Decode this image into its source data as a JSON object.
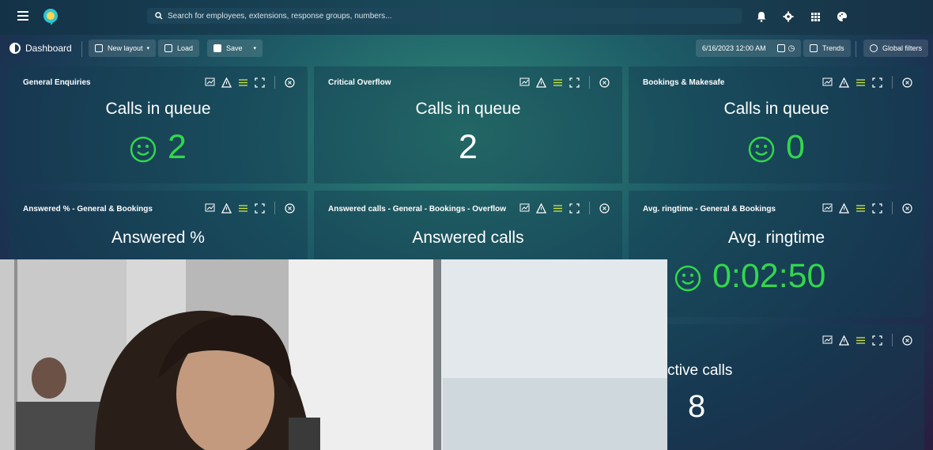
{
  "topbar": {
    "search_placeholder": "Search for employees, extensions, response groups, numbers..."
  },
  "toolbar": {
    "dashboard_label": "Dashboard",
    "new_layout_label": "New layout",
    "load_label": "Load",
    "save_label": "Save",
    "datetime": "6/16/2023 12:00 AM",
    "trends_label": "Trends",
    "global_filters_label": "Global filters"
  },
  "tiles": [
    {
      "title": "General Enquiries",
      "metric": "Calls in queue",
      "value": "2",
      "status": "green-smile"
    },
    {
      "title": "Critical Overflow",
      "metric": "Calls in queue",
      "value": "2",
      "status": "none"
    },
    {
      "title": "Bookings & Makesafe",
      "metric": "Calls in queue",
      "value": "0",
      "status": "green-smile"
    },
    {
      "title": "Answered % - General & Bookings",
      "metric": "Answered %",
      "value": "",
      "status": "none"
    },
    {
      "title": "Answered calls - General - Bookings - Overflow",
      "metric": "Answered calls",
      "value": "",
      "status": "none"
    },
    {
      "title": "Avg. ringtime - General & Bookings",
      "metric": "Avg. ringtime",
      "value": "0:02:50",
      "status": "green-smile"
    },
    {
      "title": "",
      "metric": "ctive calls",
      "value": "8",
      "status": "none"
    }
  ],
  "colors": {
    "accent_green": "#32d74b",
    "bg_teal": "#2f8a78",
    "bg_navy": "#1a3552"
  }
}
